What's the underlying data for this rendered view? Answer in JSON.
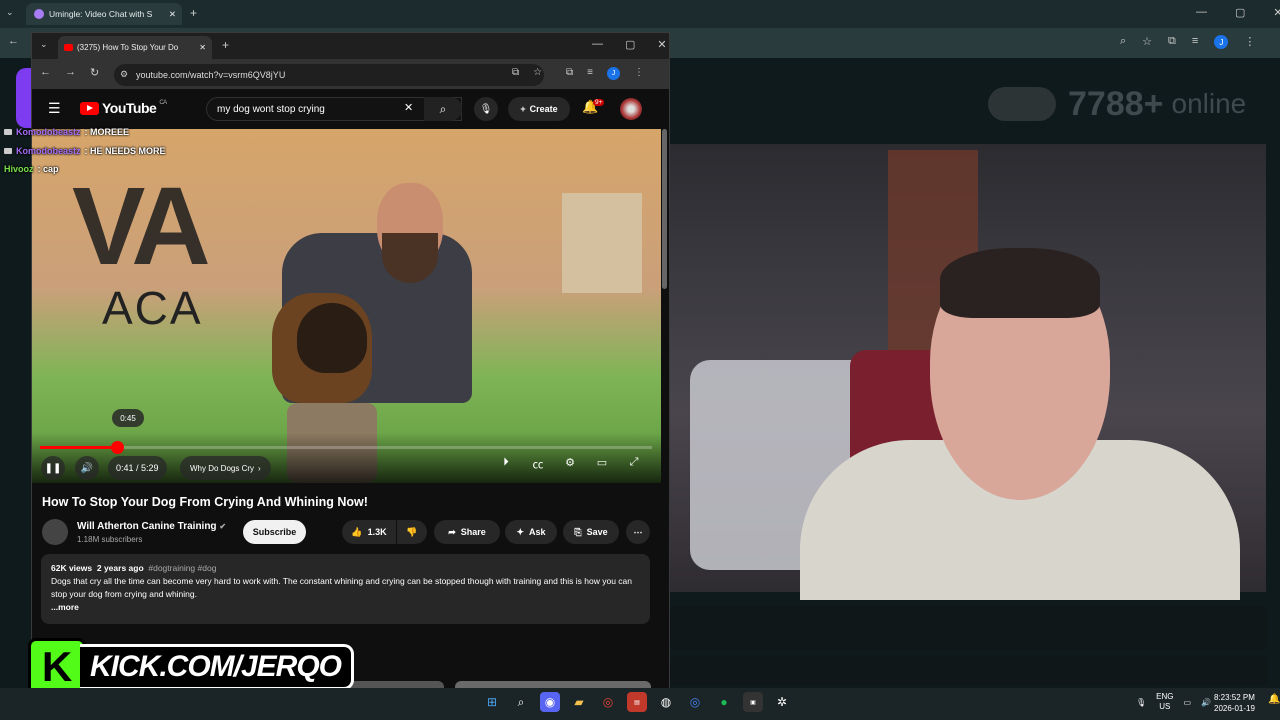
{
  "back_browser": {
    "tab_title": "Umingle: Video Chat with S",
    "online_count": "7788+",
    "online_label": "online"
  },
  "youtube_window": {
    "tab_title": "(3275) How To Stop Your Do",
    "url": "youtube.com/watch?v=vsrm6QV8jYU",
    "profile_initial": "J",
    "logo_text": "YouTube",
    "logo_region": "CA",
    "search_query": "my dog wont stop crying",
    "create_label": "Create",
    "notifications_badge": "9+",
    "video": {
      "hover_time": "0:45",
      "current_time": "0:41 / 5:29",
      "chapter": "Why Do Dogs Cry",
      "progress_fraction": 0.125
    },
    "title": "How To Stop Your Dog From Crying And Whining Now!",
    "channel_name": "Will Atherton Canine Training",
    "subscribers": "1.18M subscribers",
    "subscribe_label": "Subscribe",
    "like_count": "1.3K",
    "share_label": "Share",
    "ask_label": "Ask",
    "save_label": "Save",
    "description": {
      "views": "62K views",
      "age": "2 years ago",
      "tags": "#dogtraining #dog",
      "text": "Dogs that cry all the time can become very hard to work with. The constant whining and crying can be stopped though with training and this is how you can stop your dog from crying and whining.",
      "more": "...more"
    }
  },
  "chat": [
    {
      "user": "Komodobeastz",
      "message": ": MOREEE"
    },
    {
      "user": "Komodobeastz",
      "message": ": HE NEEDS MORE"
    },
    {
      "user": "Hivooz",
      "message": ": cap"
    }
  ],
  "kick_banner": {
    "letter": "K",
    "text": "KICK.COM/JERQO"
  },
  "taskbar": {
    "lang_top": "ENG",
    "lang_bottom": "US",
    "time": "8:23:52 PM",
    "date": "2026-01-19"
  }
}
